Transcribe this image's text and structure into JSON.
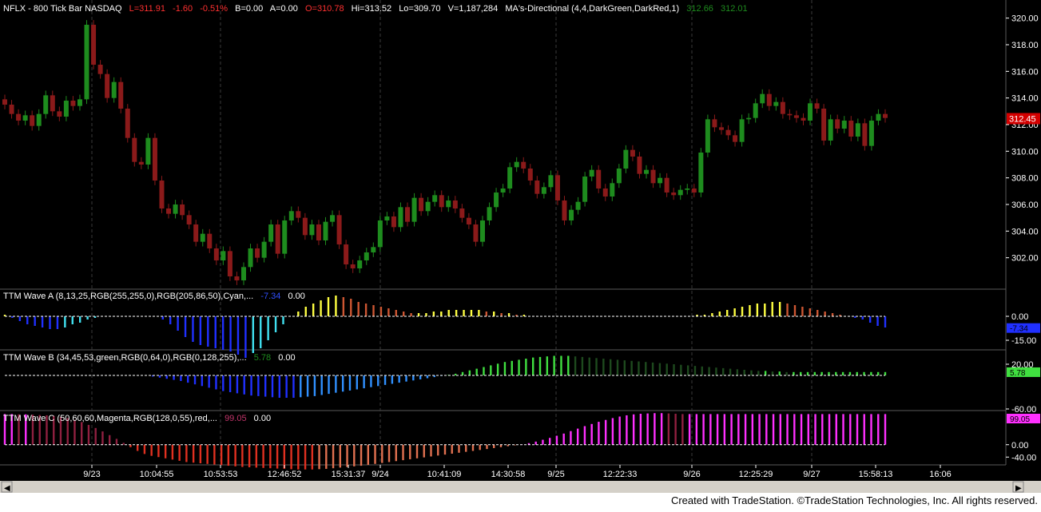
{
  "colors": {
    "background": "#000000",
    "up_candle": "#1e8c1e",
    "down_candle": "#8b1a1a",
    "title_text": "#ffffff",
    "axis_text": "#ffffff",
    "grid": "#3a3a3a",
    "price_marker": "#d40000"
  },
  "price_header": {
    "symbol_label": "NFLX - 800 Tick Bar  NASDAQ",
    "last": "L=311.91",
    "change": "-1.60",
    "change_pct": "-0.51%",
    "bid": "B=0.00",
    "ask": "A=0.00",
    "open": "O=310.78",
    "high": "Hi=313.52",
    "low": "Lo=309.70",
    "volume": "V=1,187,284",
    "study": "MA's-Directional (4,4,DarkGreen,DarkRed,1)",
    "study_v1": "312.66",
    "study_v2": "312.01"
  },
  "price_axis": {
    "ticks": [
      "320.00",
      "318.00",
      "316.00",
      "314.00",
      "312.00",
      "310.00",
      "308.00",
      "306.00",
      "304.00",
      "302.00"
    ],
    "last_marker": "312.45"
  },
  "wave_a": {
    "label": "TTM Wave A (8,13,25,RGB(255,255,0),RGB(205,86,50),Cyan,...",
    "value1": "-7.34",
    "value2": "0.00",
    "axis_ticks": [
      "0.00",
      "-15.00"
    ],
    "marker": "-7.34"
  },
  "wave_b": {
    "label": "TTM Wave B (34,45,53,green,RGB(0,64,0),RGB(0,128,255),...",
    "value1": "5.78",
    "value2": "0.00",
    "axis_ticks": [
      "20.00",
      "-60.00"
    ],
    "marker": "5.78"
  },
  "wave_c": {
    "label": "TTM Wave C (50,60,60,Magenta,RGB(128,0,55),red,...",
    "value1": "99.05",
    "value2": "0.00",
    "axis_ticks": [
      "0.00",
      "-40.00"
    ],
    "marker": "99.05"
  },
  "time_axis": {
    "labels": [
      "9/23",
      "10:04:55",
      "10:53:53",
      "12:46:52",
      "15:31:37",
      "9/24",
      "10:41:09",
      "14:30:58",
      "9/25",
      "12:22:33",
      "9/26",
      "12:25:29",
      "9/27",
      "15:58:13",
      "16:06"
    ]
  },
  "credit": "Created with TradeStation. ©TradeStation Technologies, Inc. All rights reserved.",
  "chart_data": [
    {
      "type": "candlestick",
      "title": "NFLX - 800 Tick Bar  NASDAQ",
      "ylim": [
        300,
        321
      ],
      "grid": false,
      "x_labels": [
        "9/23",
        "10:04:55",
        "10:53:53",
        "12:46:52",
        "15:31:37",
        "9/24",
        "10:41:09",
        "14:30:58",
        "9/25",
        "12:22:33",
        "9/26",
        "12:25:29",
        "9/27",
        "15:58:13",
        "16:06"
      ],
      "close": [
        313.5,
        312.8,
        312.3,
        312.7,
        311.9,
        312.8,
        314.2,
        313.0,
        312.6,
        313.8,
        313.4,
        313.9,
        319.5,
        316.5,
        315.8,
        314.0,
        315.2,
        313.2,
        311.0,
        309.2,
        309.0,
        311.0,
        307.8,
        305.7,
        305.3,
        306.0,
        305.2,
        304.5,
        303.2,
        303.8,
        302.7,
        301.8,
        302.5,
        300.6,
        300.3,
        301.3,
        302.7,
        302.0,
        303.2,
        304.5,
        302.3,
        304.8,
        305.5,
        305.0,
        303.7,
        304.5,
        303.3,
        304.7,
        305.2,
        303.0,
        301.5,
        301.2,
        301.8,
        302.4,
        302.8,
        304.8,
        305.1,
        304.3,
        305.8,
        304.7,
        306.5,
        305.5,
        306.2,
        306.7,
        305.8,
        306.3,
        305.7,
        305.0,
        304.5,
        303.2,
        304.8,
        305.8,
        306.9,
        307.2,
        308.8,
        309.2,
        308.7,
        307.8,
        306.8,
        307.3,
        308.2,
        306.3,
        304.8,
        305.6,
        306.2,
        308.1,
        308.6,
        307.2,
        306.6,
        307.6,
        308.7,
        310.1,
        309.6,
        308.3,
        308.6,
        307.6,
        308.0,
        306.9,
        306.7,
        307.1,
        307.2,
        306.9,
        309.9,
        312.4,
        311.8,
        311.6,
        311.2,
        310.7,
        312.4,
        312.5,
        313.6,
        314.3,
        313.4,
        313.7,
        312.8,
        312.7,
        312.5,
        312.3,
        313.6,
        313.2,
        310.8,
        312.4,
        311.7,
        312.3,
        311.1,
        312.1,
        310.4,
        312.3,
        312.8,
        312.5
      ],
      "series": [
        {
          "name": "MA's-Directional",
          "last": [
            312.66,
            312.01
          ]
        }
      ]
    },
    {
      "type": "bar",
      "title": "TTM Wave A (8,13,25,RGB(255,255,0),RGB(205,86,50),Cyan,...",
      "ylim": [
        -20,
        15
      ],
      "values": [
        1,
        -1,
        -3,
        -5,
        -6,
        -7,
        -8,
        -8,
        -7,
        -5,
        -4,
        -2,
        -1,
        0,
        0,
        0,
        0,
        0,
        0,
        0,
        0,
        -2,
        -5,
        -9,
        -13,
        -16,
        -18,
        -19,
        -20,
        -21,
        -22,
        -24,
        -26,
        -23,
        -20,
        -15,
        -10,
        -5,
        0,
        3,
        6,
        8,
        10,
        12,
        13,
        12,
        11,
        9,
        8,
        7,
        6,
        5,
        4,
        3,
        2,
        2,
        2,
        3,
        3,
        4,
        4,
        4,
        4,
        4,
        3,
        3,
        2,
        2,
        1,
        1,
        0,
        0,
        0,
        0,
        0,
        0,
        0,
        0,
        0,
        0,
        0,
        0,
        0,
        0,
        0,
        0,
        0,
        0,
        0,
        0,
        0,
        0,
        1,
        1,
        2,
        3,
        4,
        5,
        6,
        7,
        8,
        8,
        9,
        9,
        8,
        7,
        6,
        5,
        4,
        3,
        2,
        1,
        0,
        -1,
        -2,
        -4,
        -6,
        -7
      ],
      "series": [
        {
          "name": "",
          "last": [
            -7.34,
            0.0
          ]
        }
      ]
    },
    {
      "type": "bar",
      "title": "TTM Wave B (34,45,53,green,RGB(0,64,0),RGB(0,128,255),...",
      "ylim": [
        -60,
        40
      ],
      "values": [
        0,
        0,
        0,
        0,
        0,
        0,
        0,
        0,
        0,
        0,
        0,
        0,
        0,
        0,
        0,
        0,
        0,
        0,
        0,
        0,
        0,
        -2,
        -4,
        -6,
        -8,
        -10,
        -13,
        -16,
        -19,
        -22,
        -25,
        -28,
        -30,
        -32,
        -34,
        -36,
        -37,
        -38,
        -39,
        -40,
        -40,
        -40,
        -39,
        -38,
        -37,
        -35,
        -33,
        -31,
        -29,
        -27,
        -25,
        -23,
        -21,
        -19,
        -17,
        -15,
        -13,
        -11,
        -9,
        -7,
        -5,
        -3,
        -1,
        1,
        3,
        6,
        9,
        12,
        15,
        18,
        21,
        24,
        26,
        28,
        30,
        32,
        33,
        34,
        35,
        35,
        35,
        34,
        33,
        32,
        31,
        30,
        29,
        28,
        27,
        26,
        25,
        24,
        23,
        22,
        21,
        20,
        19,
        18,
        17,
        16,
        15,
        14,
        13,
        12,
        11,
        10,
        9,
        8,
        8,
        7,
        7,
        6,
        6,
        6,
        6,
        6,
        6,
        6,
        6,
        6,
        6,
        6,
        6,
        6,
        6,
        6
      ],
      "series": [
        {
          "name": "",
          "last": [
            5.78,
            0.0
          ]
        }
      ]
    },
    {
      "type": "bar",
      "title": "TTM Wave C (50,60,60,Magenta,RGB(128,0,55),red,...",
      "ylim": [
        -60,
        100
      ],
      "values": [
        99,
        99,
        98,
        98,
        97,
        96,
        95,
        93,
        90,
        86,
        80,
        73,
        64,
        54,
        43,
        31,
        19,
        6,
        -8,
        -20,
        -30,
        -36,
        -40,
        -44,
        -48,
        -52,
        -56,
        -58,
        -60,
        -62,
        -64,
        -66,
        -68,
        -70,
        -72,
        -73,
        -74,
        -75,
        -76,
        -77,
        -78,
        -79,
        -80,
        -80,
        -80,
        -79,
        -78,
        -76,
        -74,
        -72,
        -70,
        -68,
        -65,
        -62,
        -59,
        -56,
        -53,
        -50,
        -47,
        -44,
        -41,
        -38,
        -35,
        -32,
        -29,
        -26,
        -23,
        -20,
        -17,
        -14,
        -11,
        -8,
        -5,
        -2,
        1,
        5,
        10,
        16,
        22,
        29,
        36,
        44,
        52,
        60,
        67,
        74,
        80,
        86,
        91,
        95,
        98,
        100,
        101,
        102,
        102,
        101,
        100,
        99,
        99,
        99,
        99,
        99,
        99,
        99,
        99,
        99,
        99,
        99,
        99,
        99,
        99,
        99,
        99,
        99,
        99,
        99,
        99,
        99,
        99,
        99,
        99,
        99,
        99,
        99,
        99,
        99,
        99
      ],
      "series": [
        {
          "name": "",
          "last": [
            99.05,
            0.0
          ]
        }
      ]
    }
  ]
}
